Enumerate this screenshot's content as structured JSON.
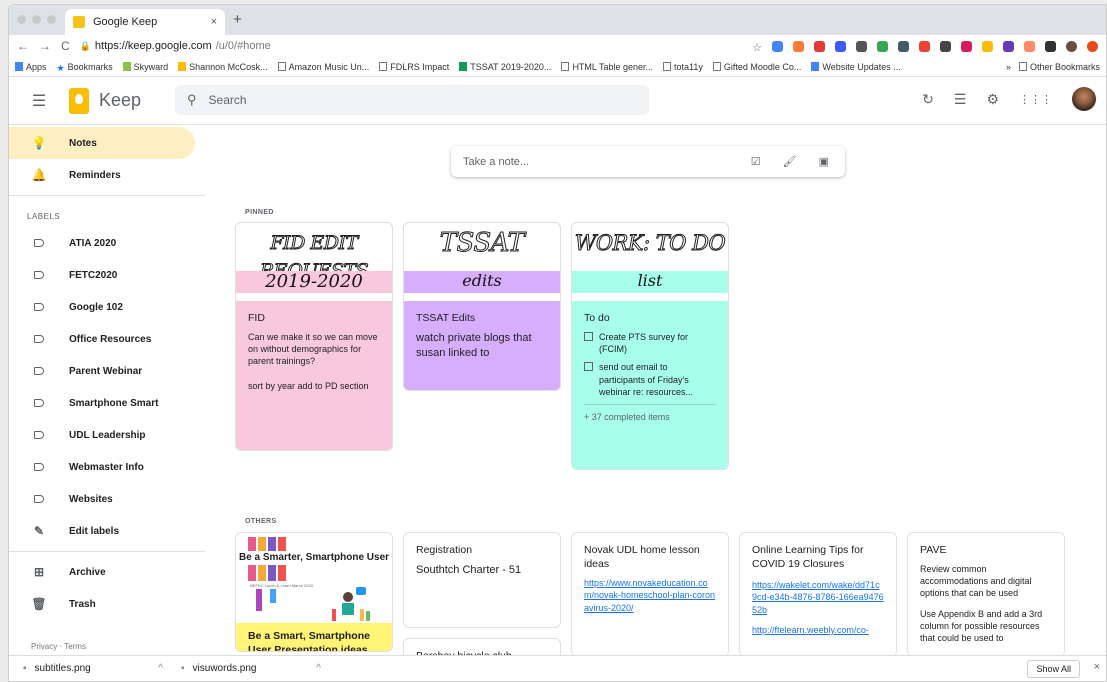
{
  "browser": {
    "tab_title": "Google Keep",
    "tab_close": "×",
    "new_tab": "+",
    "url_host": "https://keep.google.com",
    "url_path": "/u/0/#home",
    "bookmarks": [
      "Apps",
      "Bookmarks",
      "Skyward",
      "Shannon McCosk...",
      "Amazon Music Un...",
      "FDLRS Impact",
      "TSSAT 2019-2020...",
      "HTML Table gener...",
      "tota11y",
      "Gifted Moodle Co...",
      "Website Updates ..."
    ],
    "bookmarks_more": "»",
    "other_bookmarks": "Other Bookmarks"
  },
  "header": {
    "app_name": "Keep",
    "search_placeholder": "Search"
  },
  "sidebar": {
    "items": [
      {
        "label": "Notes",
        "icon": "bulb-icon"
      },
      {
        "label": "Reminders",
        "icon": "bell-icon"
      }
    ],
    "labels_heading": "LABELS",
    "labels": [
      "ATIA 2020",
      "FETC2020",
      "Google 102",
      "Office Resources",
      "Parent Webinar",
      "Smartphone Smart",
      "UDL Leadership",
      "Webmaster Info",
      "Websites"
    ],
    "edit_labels": "Edit labels",
    "archive": "Archive",
    "trash": "Trash",
    "footer": "Privacy · Terms"
  },
  "main": {
    "take_note": "Take a note...",
    "pinned_heading": "PINNED",
    "others_heading": "OTHERS",
    "pinned": [
      {
        "banner_title": "FID EDIT REQUESTS",
        "banner_sub": "2019-2020",
        "title": "FID",
        "lines": [
          "Can we make it so we can move on without demographics for parent trainings?",
          "sort by year add to PD section"
        ],
        "color": "#f8c8dc"
      },
      {
        "banner_title": "TSSAT",
        "banner_sub": "edits",
        "title": "TSSAT Edits",
        "lines": [
          "watch private blogs that susan linked to"
        ],
        "color": "#d7aefb"
      },
      {
        "banner_title": "WORK: TO DO",
        "banner_sub": "list",
        "title": "To do",
        "checklist": [
          "Create PTS survey for (FCIM)",
          "send out email to participants of Friday's webinar re: resources..."
        ],
        "completed": "+ 37 completed items",
        "color": "#a7ffeb"
      }
    ],
    "others": [
      {
        "image_title": "Be a Smarter, Smartphone User",
        "image_caption": "NEFEC Lunch & Learn March 2020",
        "title": "Be a Smart, Smartphone User Presentation ideas",
        "color": "#fff475"
      },
      {
        "title": "Registration",
        "text": "Southtch Charter - 51",
        "next_title": "Bershey bicycle club"
      },
      {
        "title": "Novak UDL home lesson ideas",
        "link": "https://www.novakeducation.com/novak-homeschool-plan-coronavirus-2020/"
      },
      {
        "title": "Online Learning Tips for COVID 19 Closures",
        "link": "https://wakelet.com/wake/dd71c9cd-e34b-4876-8786-166ea947652b",
        "link2": "http://ftelearn.weebly.com/co-"
      },
      {
        "title": "PAVE",
        "lines": [
          "Review common accommodations and digital options that can be used",
          "Use Appendix B and add a 3rd column for possible resources that could be used to"
        ]
      }
    ]
  },
  "downloads": {
    "files": [
      "subtitles.png",
      "visuwords.png"
    ],
    "show_all": "Show All",
    "close": "×"
  }
}
